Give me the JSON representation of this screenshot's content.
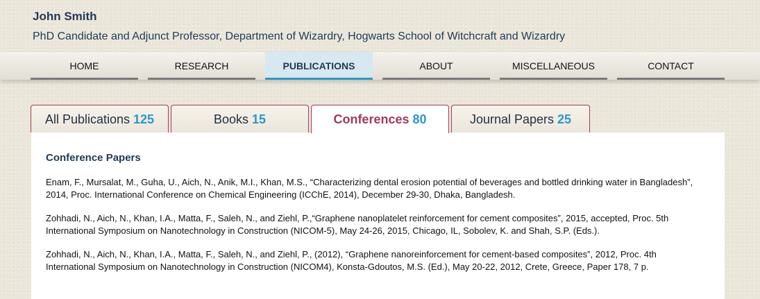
{
  "header": {
    "name": "John Smith",
    "subtitle": "PhD Candidate and Adjunct Professor, Department of Wizardry, Hogwarts School of Witchcraft and Wizardry"
  },
  "nav": {
    "items": [
      {
        "label": "HOME"
      },
      {
        "label": "RESEARCH"
      },
      {
        "label": "PUBLICATIONS",
        "active": true
      },
      {
        "label": "ABOUT"
      },
      {
        "label": "MISCELLANEOUS"
      },
      {
        "label": "CONTACT"
      }
    ]
  },
  "tabs": [
    {
      "label": "All Publications",
      "count": "125"
    },
    {
      "label": "Books",
      "count": "15"
    },
    {
      "label": "Conferences",
      "count": "80",
      "active": true
    },
    {
      "label": "Journal Papers",
      "count": "25"
    }
  ],
  "panel": {
    "title": "Conference Papers",
    "papers": [
      "Enam, F., Mursalat, M., Guha, U., Aich, N., Anik, M.I., Khan, M.S., “Characterizing dental erosion potential of beverages and bottled drinking water in Bangladesh”, 2014, Proc. International Conference on Chemical Engineering (ICChE, 2014), December 29-30, Dhaka, Bangladesh.",
      "Zohhadi, N., Aich, N., Khan, I.A., Matta, F., Saleh, N., and Ziehl, P.,“Graphene nanoplatelet reinforcement for cement composites”, 2015, accepted, Proc. 5th International Symposium on Nanotechnology in Construction (NICOM-5), May 24-26, 2015, Chicago, IL, Sobolev, K. and Shah, S.P. (Eds.).",
      "Zohhadi, N., Aich, N., Khan, I.A., Matta, F., Saleh, N., and Ziehl, P., (2012), “Graphene nanoreinforcement for cement-based composites”, 2012, Proc. 4th International Symposium on Nanotechnology in Construction (NICOM4), Konsta-Gdoutos, M.S. (Ed.), May 20-22, 2012, Crete, Greece, Paper 178, 7 p."
    ]
  },
  "colors": {
    "accent_blue": "#2a98c8",
    "accent_maroon": "#a03a5c",
    "heading_navy": "#1f3a55"
  }
}
